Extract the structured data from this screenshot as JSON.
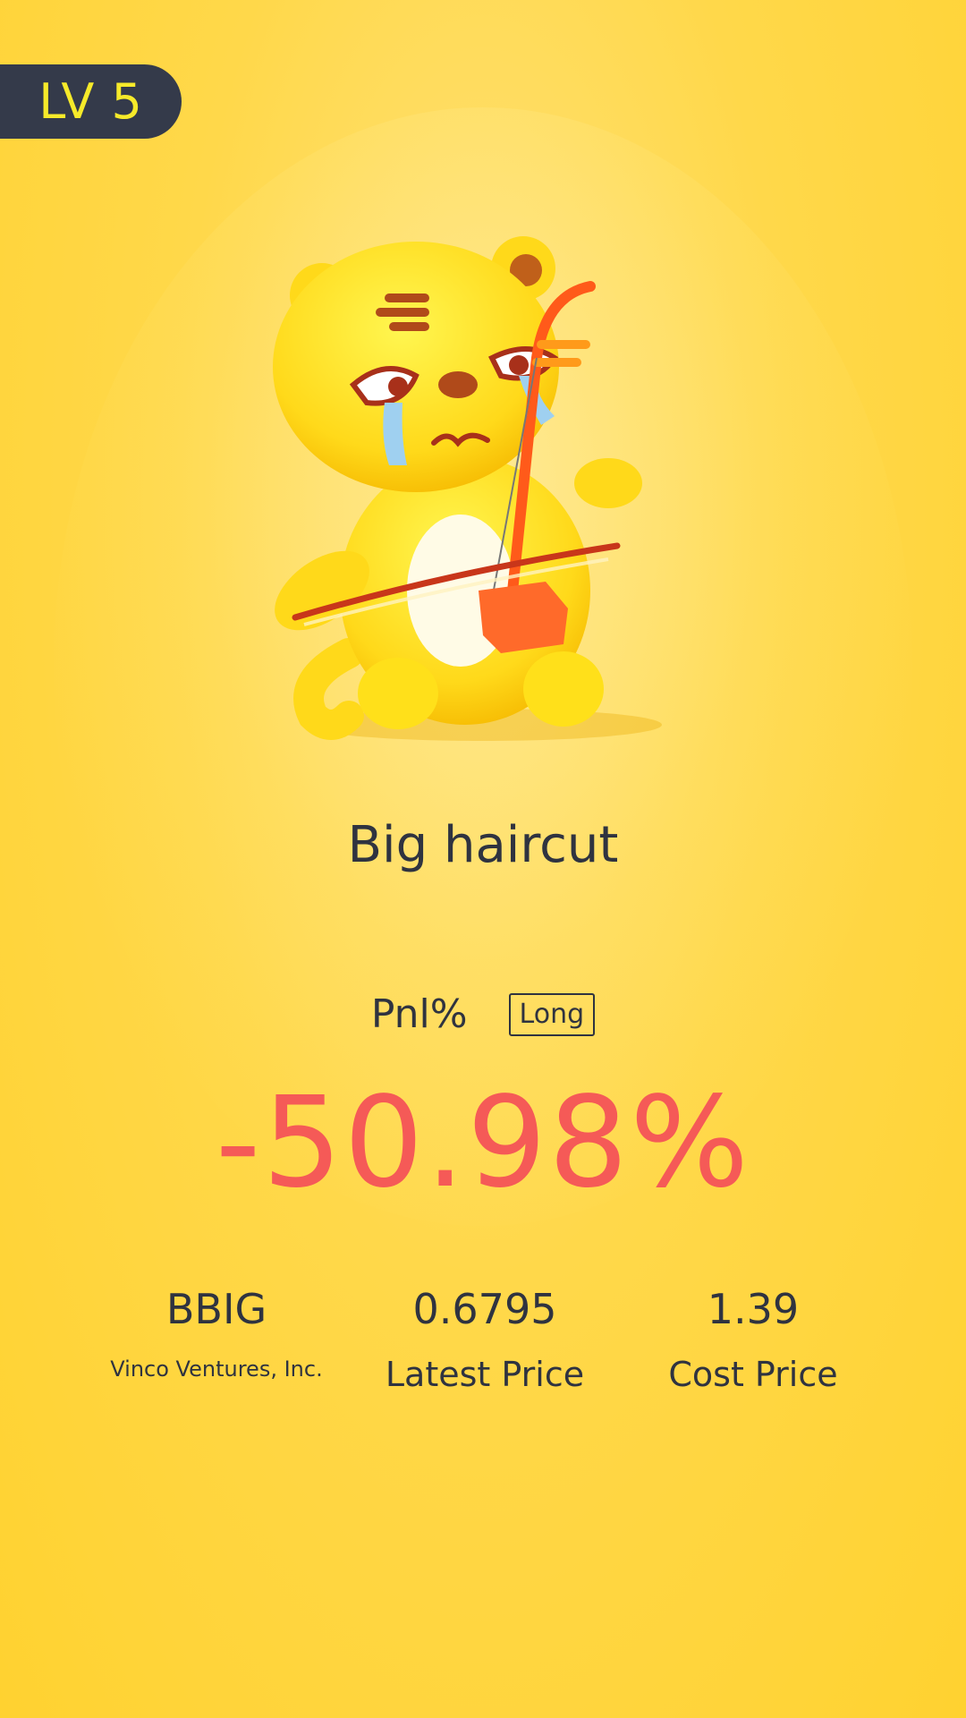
{
  "badge": {
    "level": "LV 5"
  },
  "headline": "Big haircut",
  "pnl": {
    "label": "Pnl%",
    "direction": "Long",
    "value": "-50.98%"
  },
  "stats": {
    "ticker": "BBIG",
    "company": "Vinco Ventures, Inc.",
    "latest_price": "0.6795",
    "latest_price_label": "Latest Price",
    "cost_price": "1.39",
    "cost_price_label": "Cost Price"
  },
  "colors": {
    "background": "#ffd84a",
    "badge": "#343a4a",
    "badge_text": "#f6ea2a",
    "loss": "#f55a57",
    "text": "#2f3340"
  },
  "icons": {
    "mascot": "crying-tiger-playing-erhu-icon"
  }
}
